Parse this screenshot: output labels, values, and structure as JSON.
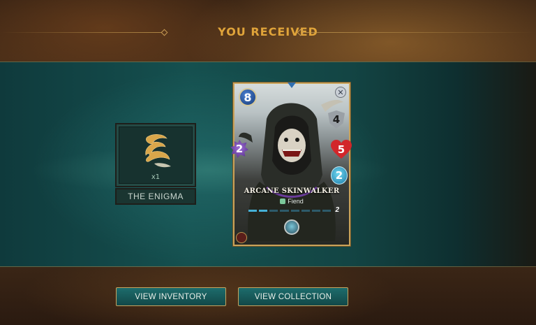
{
  "header": {
    "title": "YOU RECEIVED"
  },
  "reward_item": {
    "quantity": "x1",
    "name": "THE ENIGMA",
    "icon": "enigma-emblem-icon"
  },
  "card": {
    "mana": "8",
    "armor": "4",
    "magic": "2",
    "health": "5",
    "speed": "2",
    "name": "ARCANE SKINWALKER",
    "type": "Fiend",
    "level": "2",
    "level_segments_filled": 2,
    "level_segments_total": 8
  },
  "buttons": {
    "view_inventory": "VIEW INVENTORY",
    "view_collection": "VIEW COLLECTION"
  },
  "colors": {
    "accent_gold": "#e0a43a",
    "teal": "#15504f",
    "button_border": "#c7a35e"
  }
}
